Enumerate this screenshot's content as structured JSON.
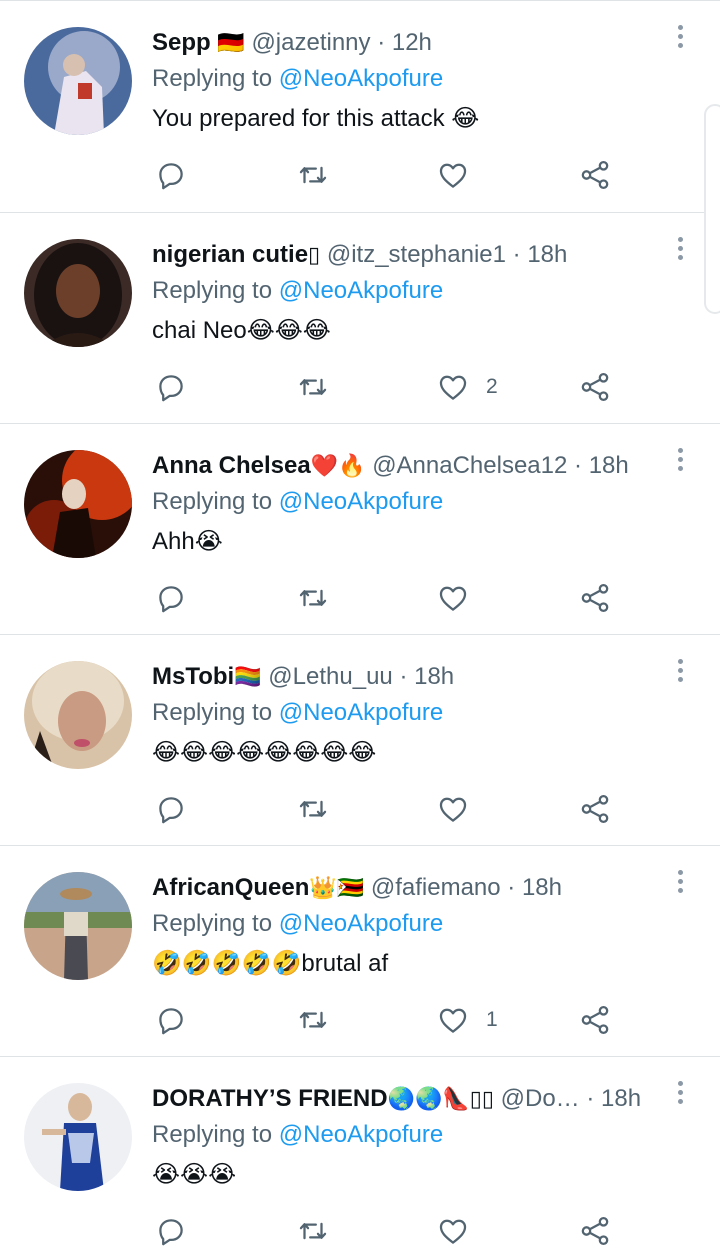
{
  "reply_prefix": "Replying to",
  "colors": {
    "link": "#1d9bf0",
    "secondary": "#536471",
    "text": "#0f1419",
    "divider": "#dfe3e6"
  },
  "tweets": [
    {
      "name": "Sepp",
      "name_emoji": "🇩🇪",
      "handle": "@jazetinny",
      "time": "· 12h",
      "replying_to": "@NeoAkpofure",
      "text": "You prepared for this attack 😂",
      "reply_count": "",
      "retweet_count": "",
      "like_count": ""
    },
    {
      "name": "nigerian cutie",
      "name_emoji": "▯",
      "handle": "@itz_stephanie1",
      "time": "· 18h",
      "replying_to": "@NeoAkpofure",
      "text": "chai Neo😂😂😂",
      "reply_count": "",
      "retweet_count": "",
      "like_count": "2"
    },
    {
      "name": "Anna Chelsea",
      "name_emoji": "❤️🔥",
      "handle": "@AnnaChelsea12",
      "time": "· 18h",
      "replying_to": "@NeoAkpofure",
      "text": "Ahh😭",
      "reply_count": "",
      "retweet_count": "",
      "like_count": ""
    },
    {
      "name": "MsTobi",
      "name_emoji": "🏳️‍🌈",
      "handle": "@Lethu_uu",
      "time": "· 18h",
      "replying_to": "@NeoAkpofure",
      "text": "😂😂😂😂😂😂😂😂",
      "reply_count": "",
      "retweet_count": "",
      "like_count": ""
    },
    {
      "name": "AfricanQueen",
      "name_emoji": "👑🇿🇼",
      "handle": "@fafiemano",
      "time": "· 18h",
      "replying_to": "@NeoAkpofure",
      "text": "🤣🤣🤣🤣🤣brutal af",
      "reply_count": "",
      "retweet_count": "",
      "like_count": "1"
    },
    {
      "name": "DORATHY’S FRIEND",
      "name_emoji": "🌏🌏👠▯▯",
      "handle": "@Do…",
      "time": "· 18h",
      "replying_to": "@NeoAkpofure",
      "text": "😭😭😭",
      "reply_count": "",
      "retweet_count": "",
      "like_count": ""
    }
  ],
  "icons": {
    "reply": "reply-icon",
    "retweet": "retweet-icon",
    "like": "heart-icon",
    "share": "share-icon",
    "more": "more-vertical-icon"
  }
}
